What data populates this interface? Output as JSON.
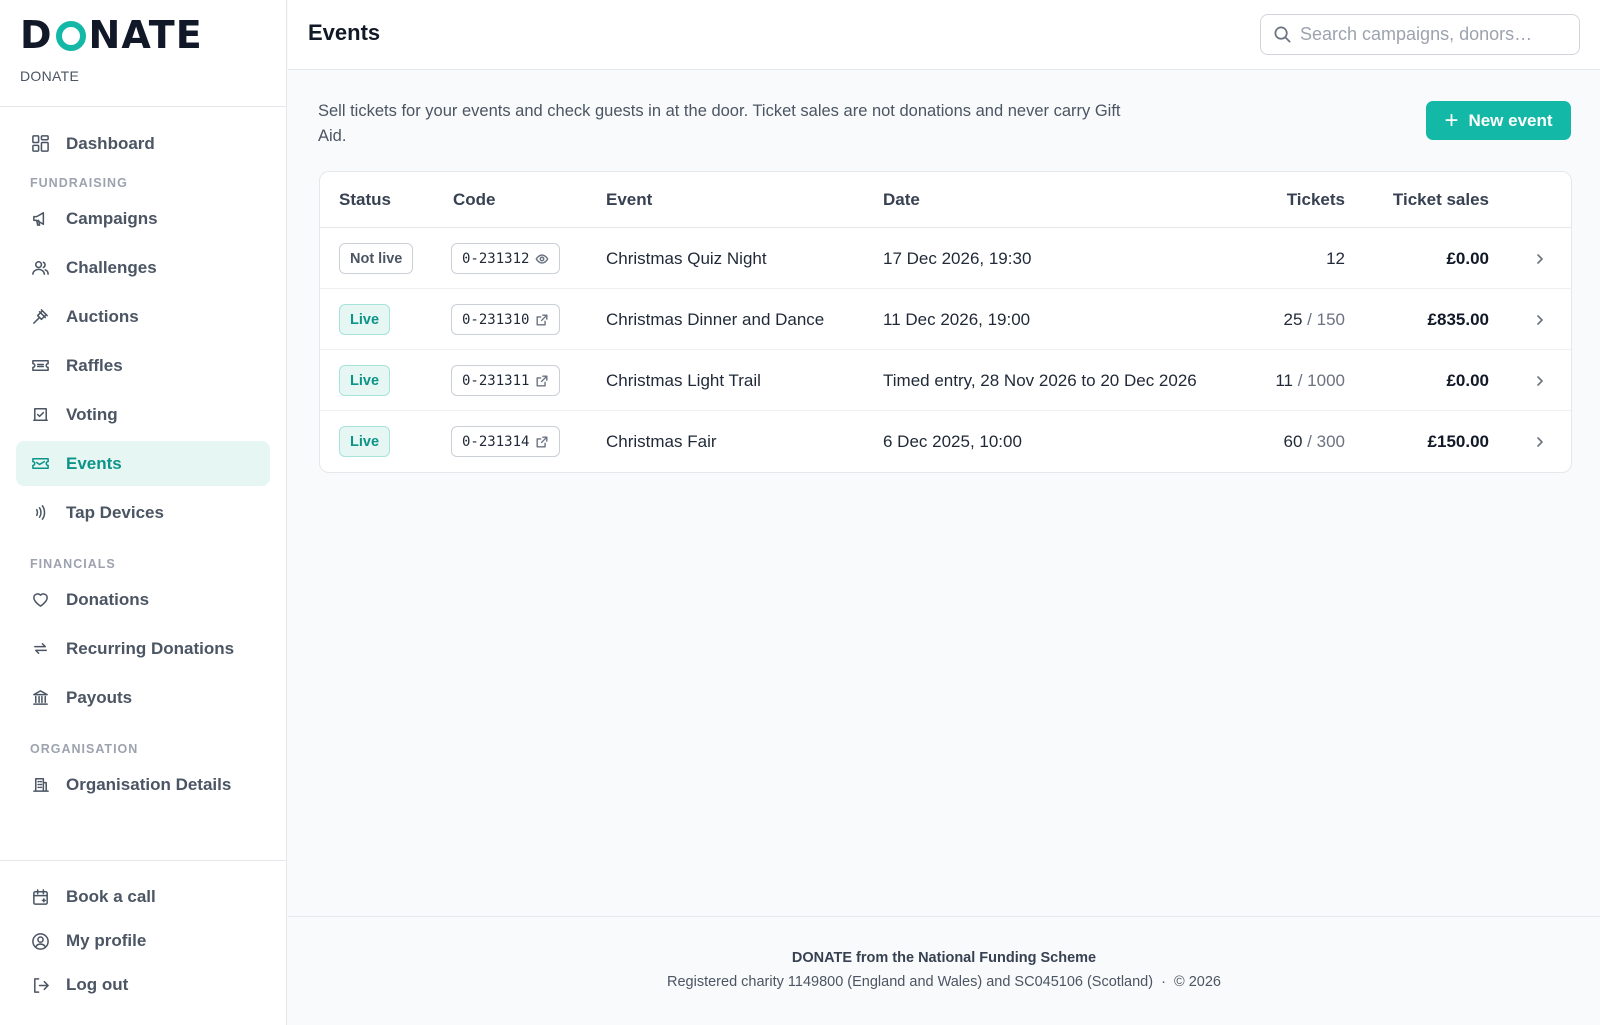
{
  "brand": {
    "logo": "DONATE",
    "org_name": "DONATE"
  },
  "nav": {
    "dashboard": "Dashboard",
    "sections": {
      "fundraising": "FUNDRAISING",
      "financials": "FINANCIALS",
      "organisation": "ORGANISATION"
    },
    "fundraising_items": [
      "Campaigns",
      "Challenges",
      "Auctions",
      "Raffles",
      "Voting",
      "Events",
      "Tap Devices"
    ],
    "financials_items": [
      "Donations",
      "Recurring Donations",
      "Payouts"
    ],
    "organisation_items": [
      "Organisation Details"
    ],
    "bottom_items": [
      "Book a call",
      "My profile",
      "Log out"
    ],
    "active": "Events"
  },
  "header": {
    "title": "Events",
    "search_placeholder": "Search campaigns, donors…"
  },
  "intro": "Sell tickets for your events and check guests in at the door. Ticket sales are not donations and never carry Gift Aid.",
  "new_button": "New event",
  "table": {
    "headers": {
      "status": "Status",
      "code": "Code",
      "event": "Event",
      "date": "Date",
      "tickets": "Tickets",
      "sales": "Ticket sales"
    },
    "rows": [
      {
        "status": "Not live",
        "code": "0-231312",
        "code_icon": "eye-icon",
        "event": "Christmas Quiz Night",
        "date": "17 Dec 2026, 19:30",
        "sold": "12",
        "sep": "",
        "capacity": "",
        "sales": "£0.00"
      },
      {
        "status": "Live",
        "code": "0-231310",
        "code_icon": "external-link-icon",
        "event": "Christmas Dinner and Dance",
        "date": "11 Dec 2026, 19:00",
        "sold": "25",
        "sep": " / ",
        "capacity": "150",
        "sales": "£835.00"
      },
      {
        "status": "Live",
        "code": "0-231311",
        "code_icon": "external-link-icon",
        "event": "Christmas Light Trail",
        "date": "Timed entry, 28 Nov 2026 to 20 Dec 2026",
        "sold": "11",
        "sep": " / ",
        "capacity": "1000",
        "sales": "£0.00"
      },
      {
        "status": "Live",
        "code": "0-231314",
        "code_icon": "external-link-icon",
        "event": "Christmas Fair",
        "date": "6 Dec 2025, 10:00",
        "sold": "60",
        "sep": " / ",
        "capacity": "300",
        "sales": "£150.00"
      }
    ]
  },
  "footer": {
    "title": "DONATE from the National Funding Scheme",
    "line": "Registered charity 1149800 (England and Wales) and SC045106 (Scotland)  ·  © 2026"
  },
  "colors": {
    "accent": "#14b8a6",
    "accent_text": "#0d9488",
    "active_bg": "#e6f6f3"
  }
}
